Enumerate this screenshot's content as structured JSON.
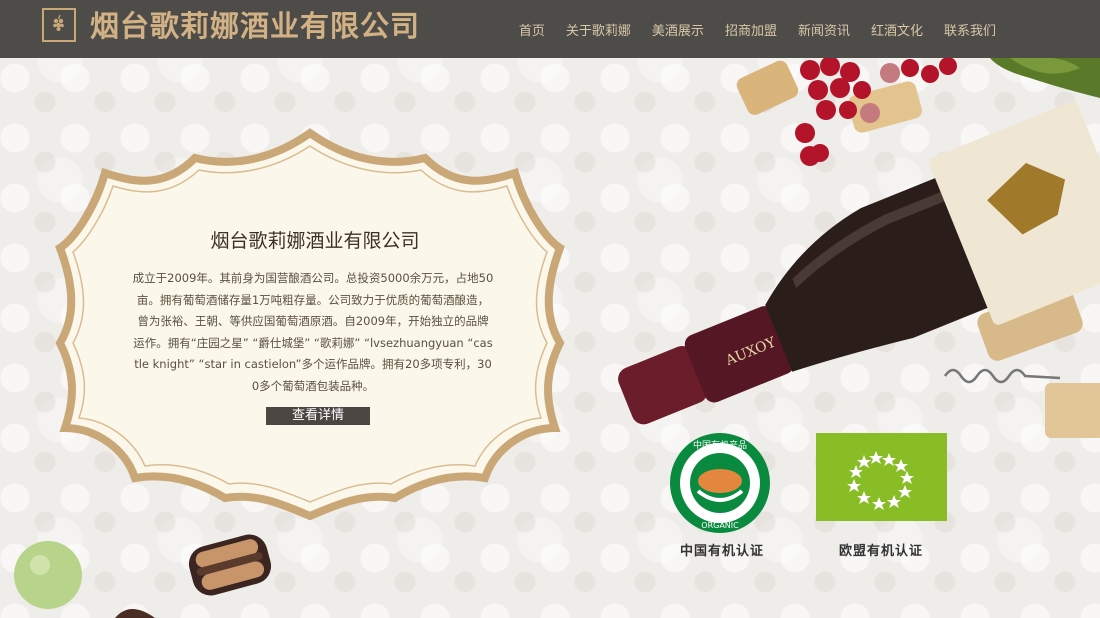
{
  "header": {
    "brand": "烟台歌莉娜酒业有限公司",
    "logo_icon": "grape-logo-icon",
    "nav": [
      {
        "label": "首页"
      },
      {
        "label": "关于歌莉娜"
      },
      {
        "label": "美酒展示"
      },
      {
        "label": "招商加盟"
      },
      {
        "label": "新闻资讯"
      },
      {
        "label": "红酒文化"
      },
      {
        "label": "联系我们"
      }
    ]
  },
  "intro": {
    "title": "烟台歌莉娜酒业有限公司",
    "body": "成立于2009年。其前身为国营酿酒公司。总投资5000余万元，占地50亩。拥有葡萄酒储存量1万吨粗存量。公司致力于优质的葡萄酒酿造，曾为张裕、王朝、等供应国葡萄酒原酒。自2009年，开始独立的品牌运作。拥有“庄园之星” “爵仕城堡” “歌莉娜” “lvsezhuangyuan “castle knight” “star in castielon”多个运作品牌。拥有20多项专利，300多个葡萄酒包装品种。",
    "button": "查看详情"
  },
  "certs": {
    "cn_label": "中国有机认证",
    "eu_label": "欧盟有机认证",
    "cn_badge_top": "中国有机产品",
    "cn_badge_bottom": "ORGANIC"
  },
  "bottle_label": "AUXOY",
  "colors": {
    "header_bg": "#4e4c49",
    "brand_gold": "#d2b184",
    "nav_text": "#d8c7a8",
    "eu_green": "#89bd25",
    "cn_green": "#0a8a3e",
    "wine": "#6b1d2b"
  }
}
